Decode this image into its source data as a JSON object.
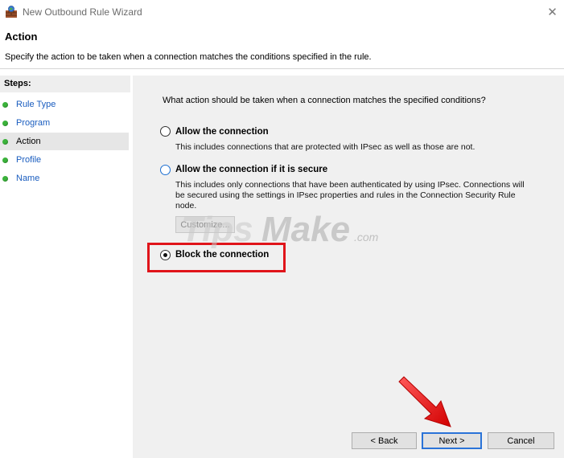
{
  "window": {
    "title": "New Outbound Rule Wizard",
    "close_glyph": "✕"
  },
  "header": {
    "title": "Action",
    "description": "Specify the action to be taken when a connection matches the conditions specified in the rule."
  },
  "steps": {
    "title": "Steps:",
    "items": [
      {
        "label": "Rule Type"
      },
      {
        "label": "Program"
      },
      {
        "label": "Action"
      },
      {
        "label": "Profile"
      },
      {
        "label": "Name"
      }
    ],
    "current": "Action",
    "dot_color": "#3bb33b"
  },
  "content": {
    "question": "What action should be taken when a connection matches the specified conditions?",
    "options": [
      {
        "label": "Allow the connection",
        "description": "This includes connections that are protected with IPsec as well as those are not.",
        "selected": false
      },
      {
        "label": "Allow the connection if it is secure",
        "description": "This includes only connections that have been authenticated by using IPsec.  Connections will be secured using the settings in IPsec properties and rules in the Connection Security Rule node.",
        "selected": false
      },
      {
        "label": "Block the connection",
        "description": "",
        "selected": true
      }
    ],
    "customize_label": "Customize...",
    "highlight_color": "#e0141a"
  },
  "watermark": {
    "text_tips": "Tips",
    "text_make": "Make",
    "text_dotcom": ".com"
  },
  "buttons": {
    "back": "< Back",
    "next": "Next >",
    "cancel": "Cancel"
  },
  "icons": {
    "app": "firewall-icon",
    "close": "close-icon",
    "annotation": "red-arrow-icon"
  }
}
